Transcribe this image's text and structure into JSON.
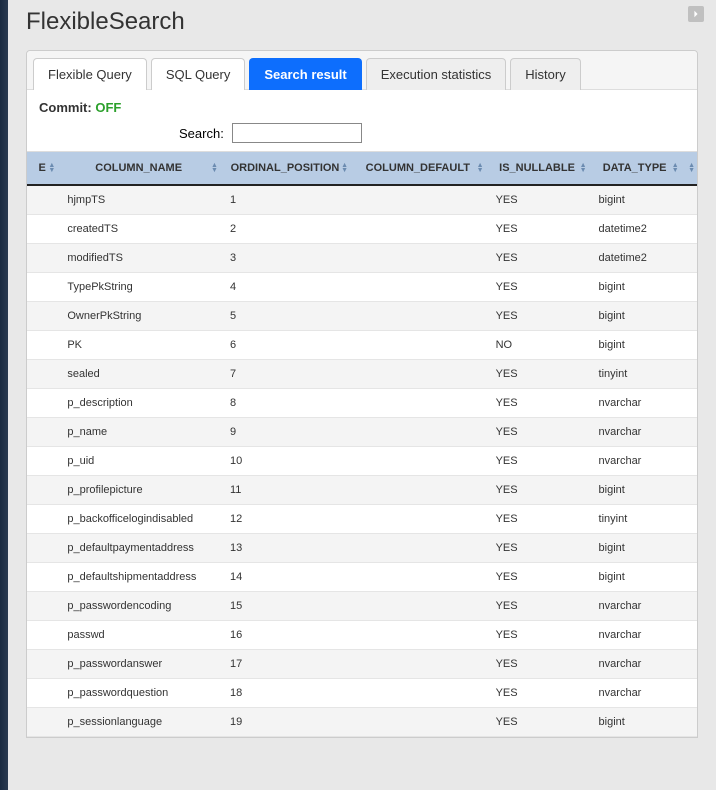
{
  "page_title": "FlexibleSearch",
  "tabs": [
    {
      "label": "Flexible Query",
      "active": false,
      "style": ""
    },
    {
      "label": "SQL Query",
      "active": false,
      "style": ""
    },
    {
      "label": "Search result",
      "active": true,
      "style": ""
    },
    {
      "label": "Execution statistics",
      "active": false,
      "style": "inactive-gray"
    },
    {
      "label": "History",
      "active": false,
      "style": "inactive-gray"
    }
  ],
  "commit": {
    "label": "Commit:",
    "value": "OFF"
  },
  "search": {
    "label": "Search:",
    "value": ""
  },
  "columns": [
    {
      "key": "first_fragment",
      "label": "E"
    },
    {
      "key": "column_name",
      "label": "COLUMN_NAME"
    },
    {
      "key": "ordinal_position",
      "label": "ORDINAL_POSITION"
    },
    {
      "key": "column_default",
      "label": "COLUMN_DEFAULT"
    },
    {
      "key": "is_nullable",
      "label": "IS_NULLABLE"
    },
    {
      "key": "data_type",
      "label": "DATA_TYPE"
    },
    {
      "key": "last_fragment",
      "label": ""
    }
  ],
  "rows": [
    {
      "column_name": "hjmpTS",
      "ordinal_position": "1",
      "column_default": "",
      "is_nullable": "YES",
      "data_type": "bigint"
    },
    {
      "column_name": "createdTS",
      "ordinal_position": "2",
      "column_default": "",
      "is_nullable": "YES",
      "data_type": "datetime2"
    },
    {
      "column_name": "modifiedTS",
      "ordinal_position": "3",
      "column_default": "",
      "is_nullable": "YES",
      "data_type": "datetime2"
    },
    {
      "column_name": "TypePkString",
      "ordinal_position": "4",
      "column_default": "",
      "is_nullable": "YES",
      "data_type": "bigint"
    },
    {
      "column_name": "OwnerPkString",
      "ordinal_position": "5",
      "column_default": "",
      "is_nullable": "YES",
      "data_type": "bigint"
    },
    {
      "column_name": "PK",
      "ordinal_position": "6",
      "column_default": "",
      "is_nullable": "NO",
      "data_type": "bigint"
    },
    {
      "column_name": "sealed",
      "ordinal_position": "7",
      "column_default": "",
      "is_nullable": "YES",
      "data_type": "tinyint"
    },
    {
      "column_name": "p_description",
      "ordinal_position": "8",
      "column_default": "",
      "is_nullable": "YES",
      "data_type": "nvarchar"
    },
    {
      "column_name": "p_name",
      "ordinal_position": "9",
      "column_default": "",
      "is_nullable": "YES",
      "data_type": "nvarchar"
    },
    {
      "column_name": "p_uid",
      "ordinal_position": "10",
      "column_default": "",
      "is_nullable": "YES",
      "data_type": "nvarchar"
    },
    {
      "column_name": "p_profilepicture",
      "ordinal_position": "11",
      "column_default": "",
      "is_nullable": "YES",
      "data_type": "bigint"
    },
    {
      "column_name": "p_backofficelogindisabled",
      "ordinal_position": "12",
      "column_default": "",
      "is_nullable": "YES",
      "data_type": "tinyint"
    },
    {
      "column_name": "p_defaultpaymentaddress",
      "ordinal_position": "13",
      "column_default": "",
      "is_nullable": "YES",
      "data_type": "bigint"
    },
    {
      "column_name": "p_defaultshipmentaddress",
      "ordinal_position": "14",
      "column_default": "",
      "is_nullable": "YES",
      "data_type": "bigint"
    },
    {
      "column_name": "p_passwordencoding",
      "ordinal_position": "15",
      "column_default": "",
      "is_nullable": "YES",
      "data_type": "nvarchar"
    },
    {
      "column_name": "passwd",
      "ordinal_position": "16",
      "column_default": "",
      "is_nullable": "YES",
      "data_type": "nvarchar"
    },
    {
      "column_name": "p_passwordanswer",
      "ordinal_position": "17",
      "column_default": "",
      "is_nullable": "YES",
      "data_type": "nvarchar"
    },
    {
      "column_name": "p_passwordquestion",
      "ordinal_position": "18",
      "column_default": "",
      "is_nullable": "YES",
      "data_type": "nvarchar"
    },
    {
      "column_name": "p_sessionlanguage",
      "ordinal_position": "19",
      "column_default": "",
      "is_nullable": "YES",
      "data_type": "bigint"
    }
  ]
}
